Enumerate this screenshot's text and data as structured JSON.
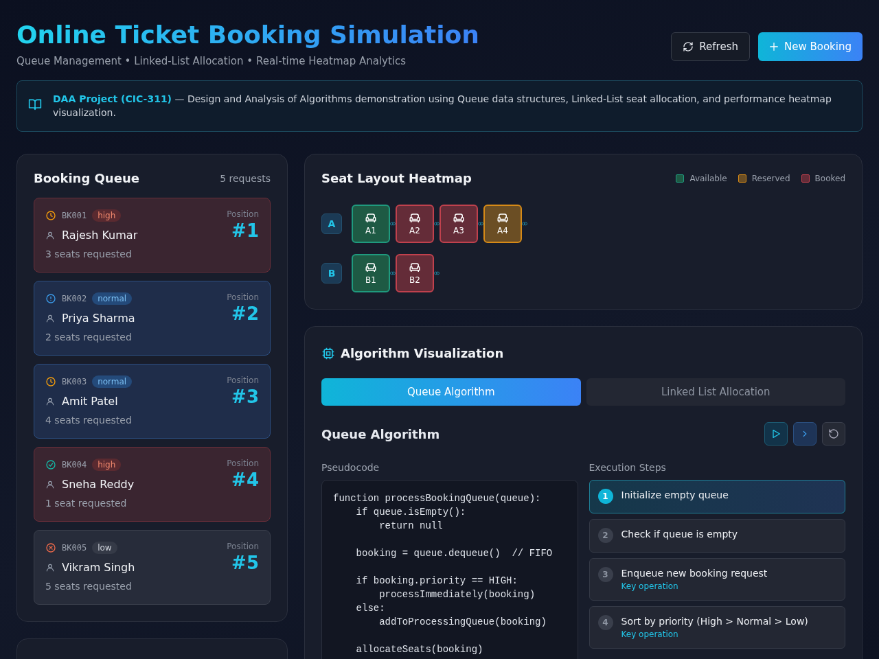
{
  "header": {
    "title": "Online Ticket Booking Simulation",
    "subtitle": "Queue Management • Linked-List Allocation • Real-time Heatmap Analytics",
    "buttons": [
      {
        "kind": "refresh",
        "label": "Refresh"
      },
      {
        "kind": "new",
        "label": "New Booking"
      }
    ]
  },
  "banner": {
    "text": "**DAA Project (CIC-311)** — Design and Analysis of Algorithms demonstration using Queue data structures, Linked-List seat allocation, and performance heatmap visualization."
  },
  "queue": {
    "title": "Booking Queue",
    "count": "5 requests",
    "items": [
      {
        "id": "BK001",
        "kind": "pending",
        "priority": "high",
        "name": "Rajesh Kumar",
        "seats": "3 seats requested",
        "position_label": "Position",
        "position": "#1"
      },
      {
        "id": "BK002",
        "kind": "info",
        "priority": "normal",
        "name": "Priya Sharma",
        "seats": "2 seats requested",
        "position_label": "Position",
        "position": "#2"
      },
      {
        "id": "BK003",
        "kind": "pending",
        "priority": "normal",
        "name": "Amit Patel",
        "seats": "4 seats requested",
        "position_label": "Position",
        "position": "#3"
      },
      {
        "id": "BK004",
        "kind": "done",
        "priority": "high",
        "name": "Sneha Reddy",
        "seats": "1 seat requested",
        "position_label": "Position",
        "position": "#4"
      },
      {
        "id": "BK005",
        "kind": "failed",
        "priority": "low",
        "name": "Vikram Singh",
        "seats": "5 seats requested",
        "position_label": "Position",
        "position": "#5"
      }
    ]
  },
  "heatmap": {
    "title": "Seat Layout Heatmap",
    "legend": [
      {
        "kind": "available",
        "label": "Available"
      },
      {
        "kind": "reserved",
        "label": "Reserved"
      },
      {
        "kind": "booked",
        "label": "Booked"
      }
    ],
    "rows": [
      {
        "label": "A",
        "seats": [
          {
            "label": "A1",
            "kind": "available"
          },
          {
            "label": "A2",
            "kind": "booked"
          },
          {
            "label": "A3",
            "kind": "booked"
          },
          {
            "label": "A4",
            "kind": "reserved"
          }
        ]
      },
      {
        "label": "B",
        "seats": [
          {
            "label": "B1",
            "kind": "available"
          },
          {
            "label": "B2",
            "kind": "booked"
          }
        ]
      }
    ]
  },
  "algorithm": {
    "title": "Algorithm Visualization",
    "tabs": [
      {
        "label": "Queue Algorithm",
        "selected": true
      },
      {
        "label": "Linked List Allocation",
        "selected": false
      }
    ],
    "subtitle": "Queue Algorithm",
    "pseudocode_label": "Pseudocode",
    "steps_label": "Execution Steps",
    "code_blocks": [
      [
        "function processBookingQueue(queue):",
        "    if queue.isEmpty():",
        "        return null"
      ],
      [
        "    booking = queue.dequeue()  // FIFO"
      ],
      [
        "    if booking.priority == HIGH:",
        "        processImmediately(booking)",
        "    else:",
        "        addToProcessingQueue(booking)"
      ],
      [
        "    allocateSeats(booking)"
      ]
    ],
    "steps": [
      {
        "number": "1",
        "label": "Initialize empty queue",
        "selected": true
      },
      {
        "number": "2",
        "label": "Check if queue is empty",
        "selected": false
      },
      {
        "number": "3",
        "label": "Enqueue new booking request",
        "note": "Key operation",
        "selected": false
      },
      {
        "number": "4",
        "label": "Sort by priority (High > Normal > Low)",
        "note": "Key operation",
        "selected": false
      }
    ]
  }
}
